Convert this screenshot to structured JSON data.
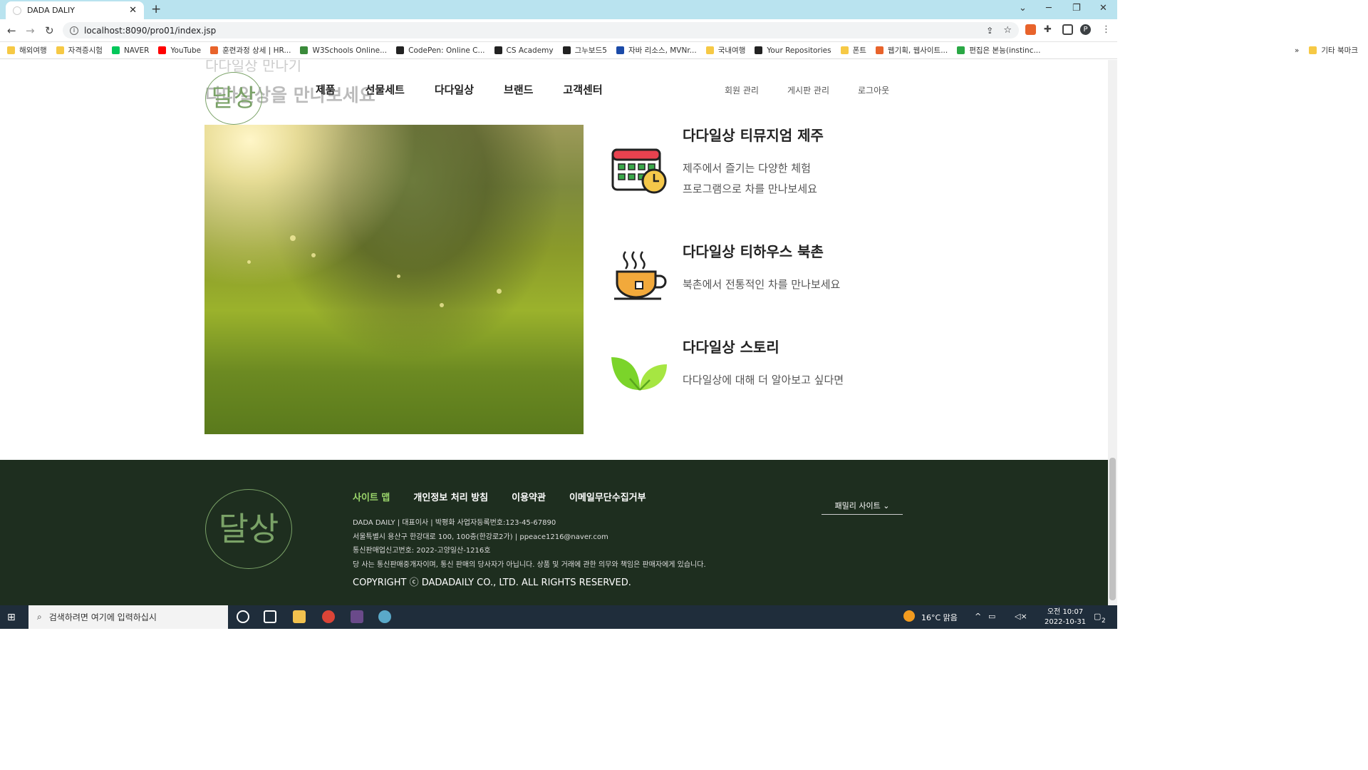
{
  "browser": {
    "tab_title": "DADA DALIY",
    "url": "localhost:8090/pro01/index.jsp",
    "bookmarks": [
      "해외여행",
      "자격증시험",
      "NAVER",
      "YouTube",
      "훈련과정 상세 | HR...",
      "W3Schools Online...",
      "CodePen: Online C...",
      "CS Academy",
      "그누보드5",
      "자바 리소스, MVNr...",
      "국내여행",
      "Your Repositories",
      "폰트",
      "웹기획, 웹사이트...",
      "편집은 본능(instinc..."
    ],
    "bookmarks_other": "기타 북마크",
    "bookmarks_more": "»"
  },
  "header": {
    "ghost_subtitle": "다다일상 만나기",
    "ghost_title": "다다일상을 만나보세요",
    "logo_text": "달상",
    "nav": [
      "제품",
      "선물세트",
      "다다일상",
      "브랜드",
      "고객센터"
    ],
    "util": [
      "회원 관리",
      "게시판 관리",
      "로그아웃"
    ]
  },
  "features": [
    {
      "icon": "calendar-clock-icon",
      "title": "다다일상 티뮤지엄 제주",
      "desc": [
        "제주에서 즐기는 다양한 체험",
        "프로그램으로 차를 만나보세요"
      ]
    },
    {
      "icon": "tea-cup-icon",
      "title": "다다일상 티하우스 북촌",
      "desc": [
        "북촌에서 전통적인 차를 만나보세요"
      ]
    },
    {
      "icon": "leaf-icon",
      "title": "다다일상 스토리",
      "desc": [
        "다다일상에 대해 더 알아보고 싶다면"
      ]
    }
  ],
  "footer": {
    "logo_text": "달상",
    "links": [
      "사이트 맵",
      "개인정보 처리 방침",
      "이용약관",
      "이메일무단수집거부"
    ],
    "info": [
      "DADA DAILY | 대표이사 | 박평화 사업자등록번호:123-45-67890",
      "서울특별시 용산구 한강대로 100, 100층(한강로2가) | ppeace1216@naver.com",
      "통신판매업신고번호: 2022-고양일산-1216호",
      "당 사는 통신판매중개자이며, 통신 판매의 당사자가 아닙니다. 상품 및 거래에 관한 의무와 책임은 판매자에게 있습니다."
    ],
    "copyright": "COPYRIGHT ⓒ DADADAILY CO., LTD. ALL RIGHTS RESERVED.",
    "family_site": "패밀리 사이트 ⌄"
  },
  "taskbar": {
    "search_placeholder": "검색하려면 여기에 입력하십시",
    "weather": "16°C  맑음",
    "time": "오전 10:07",
    "date": "2022-10-31",
    "notifications": "2"
  },
  "colors": {
    "footer_bg": "#1e2e1f",
    "accent_green": "#9bd66b",
    "logo_green": "#7aa267"
  }
}
